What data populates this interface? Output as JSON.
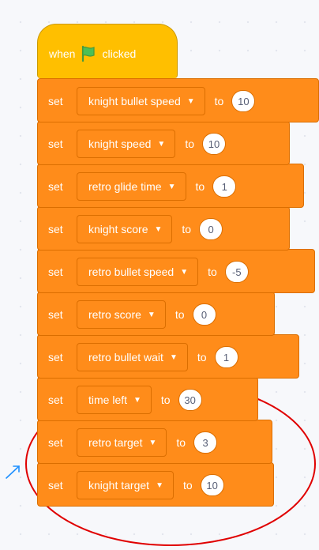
{
  "hat": {
    "when": "when",
    "clicked": "clicked",
    "icon": "green-flag-icon"
  },
  "set_label": "set",
  "to_label": "to",
  "blocks": [
    {
      "variable": "knight bullet speed",
      "value": "10"
    },
    {
      "variable": "knight speed",
      "value": "10"
    },
    {
      "variable": "retro glide time",
      "value": "1"
    },
    {
      "variable": "knight score",
      "value": "0"
    },
    {
      "variable": "retro bullet speed",
      "value": "-5"
    },
    {
      "variable": "retro score",
      "value": "0"
    },
    {
      "variable": "retro bullet wait",
      "value": "1"
    },
    {
      "variable": "time left",
      "value": "30"
    },
    {
      "variable": "retro target",
      "value": "3"
    },
    {
      "variable": "knight target",
      "value": "10"
    }
  ],
  "colors": {
    "event": "#ffbf00",
    "variables": "#ff8c1a",
    "annotation": "#e00000",
    "arrow": "#1e90ff"
  }
}
